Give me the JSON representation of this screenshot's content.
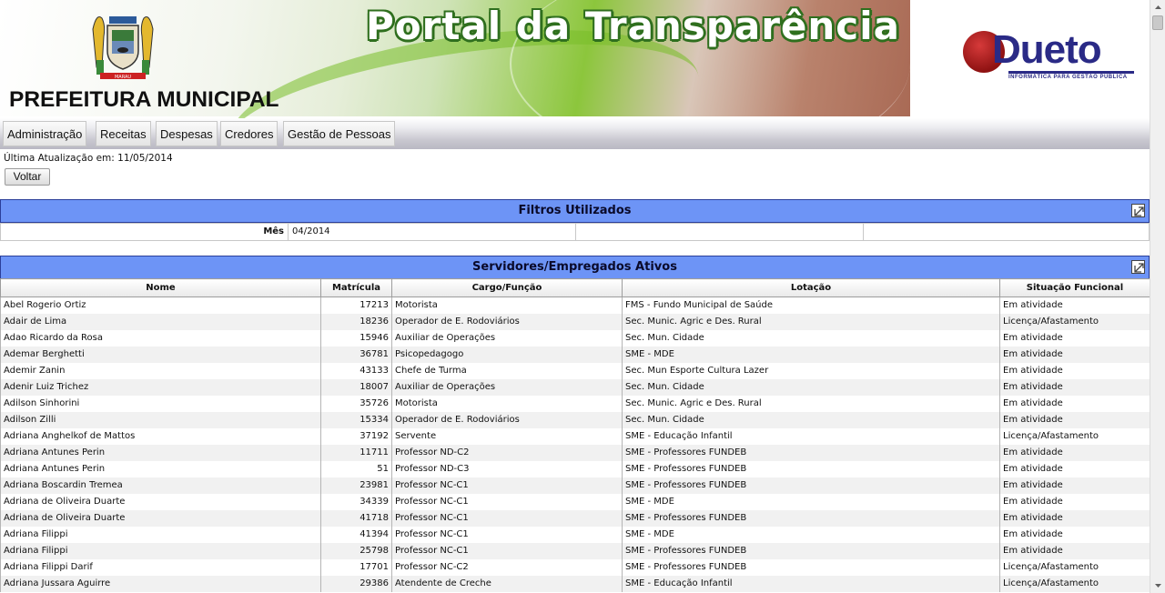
{
  "header": {
    "portal_title": "Portal da Transparência",
    "prefeitura": "PREFEITURA MUNICIPAL",
    "dueto_name": "Dueto",
    "dueto_tagline": "INFORMÁTICA PARA GESTÃO PÚBLICA",
    "coat_text": "MARAU"
  },
  "nav": {
    "items": [
      {
        "label": "Administração"
      },
      {
        "label": "Receitas"
      },
      {
        "label": "Despesas"
      },
      {
        "label": "Credores"
      },
      {
        "label": "Gestão de Pessoas"
      }
    ]
  },
  "last_update": "Última Atualização em: 11/05/2014",
  "voltar_label": "Voltar",
  "filters": {
    "title": "Filtros Utilizados",
    "label": "Mês",
    "value": "04/2014"
  },
  "servidores": {
    "title": "Servidores/Empregados Ativos",
    "columns": [
      "Nome",
      "Matrícula",
      "Cargo/Função",
      "Lotação",
      "Situação Funcional"
    ],
    "rows": [
      [
        "Abel Rogerio Ortiz",
        "17213",
        "Motorista",
        "FMS - Fundo Municipal de Saúde",
        "Em atividade"
      ],
      [
        "Adair de Lima",
        "18236",
        "Operador de E. Rodoviários",
        "Sec. Munic. Agric e Des. Rural",
        "Licença/Afastamento"
      ],
      [
        "Adao Ricardo da Rosa",
        "15946",
        "Auxiliar de Operações",
        "Sec. Mun. Cidade",
        "Em atividade"
      ],
      [
        "Ademar Berghetti",
        "36781",
        "Psicopedagogo",
        "SME - MDE",
        "Em atividade"
      ],
      [
        "Ademir Zanin",
        "43133",
        "Chefe de Turma",
        "Sec. Mun Esporte Cultura Lazer",
        "Em atividade"
      ],
      [
        "Adenir Luiz Trichez",
        "18007",
        "Auxiliar de Operações",
        "Sec. Mun. Cidade",
        "Em atividade"
      ],
      [
        "Adilson Sinhorini",
        "35726",
        "Motorista",
        "Sec. Munic. Agric e Des. Rural",
        "Em atividade"
      ],
      [
        "Adilson Zilli",
        "15334",
        "Operador de E. Rodoviários",
        "Sec. Mun. Cidade",
        "Em atividade"
      ],
      [
        "Adriana Anghelkof de Mattos",
        "37192",
        "Servente",
        "SME - Educação Infantil",
        "Licença/Afastamento"
      ],
      [
        "Adriana Antunes Perin",
        "11711",
        "Professor ND-C2",
        "SME - Professores FUNDEB",
        "Em atividade"
      ],
      [
        "Adriana Antunes Perin",
        "51",
        "Professor ND-C3",
        "SME - Professores FUNDEB",
        "Em atividade"
      ],
      [
        "Adriana Boscardin Tremea",
        "23981",
        "Professor NC-C1",
        "SME - Professores FUNDEB",
        "Em atividade"
      ],
      [
        "Adriana de Oliveira Duarte",
        "34339",
        "Professor NC-C1",
        "SME - MDE",
        "Em atividade"
      ],
      [
        "Adriana de Oliveira Duarte",
        "41718",
        "Professor NC-C1",
        "SME - Professores FUNDEB",
        "Em atividade"
      ],
      [
        "Adriana Filippi",
        "41394",
        "Professor NC-C1",
        "SME - MDE",
        "Em atividade"
      ],
      [
        "Adriana Filippi",
        "25798",
        "Professor NC-C1",
        "SME - Professores FUNDEB",
        "Em atividade"
      ],
      [
        "Adriana Filippi Darif",
        "17701",
        "Professor NC-C2",
        "SME - Professores FUNDEB",
        "Licença/Afastamento"
      ],
      [
        "Adriana Jussara Aguirre",
        "29386",
        "Atendente de Creche",
        "SME - Educação Infantil",
        "Licença/Afastamento"
      ]
    ]
  },
  "colors": {
    "panel_header": "#6d94f6",
    "portal_title_outline": "#2f6f1e",
    "dueto_blue": "#2a2a86",
    "dueto_red": "#b52020"
  }
}
